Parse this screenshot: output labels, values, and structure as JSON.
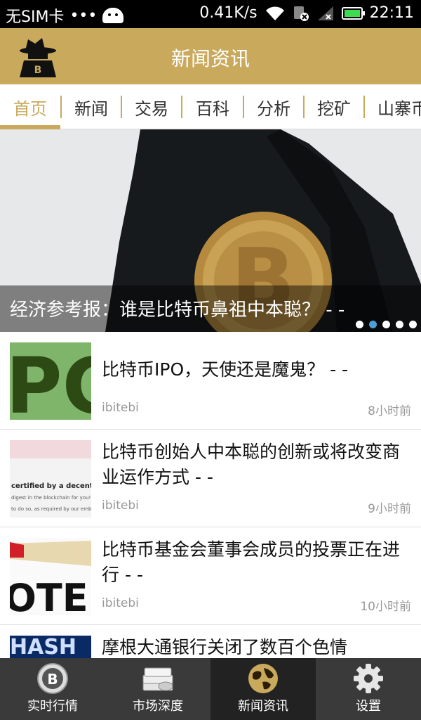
{
  "status_bar": {
    "sim": "无SIM卡",
    "dots": "•••",
    "speed": "0.41K/s",
    "time": "22:11",
    "battery_level": 1.0
  },
  "header": {
    "title": "新闻资讯"
  },
  "tabs": [
    {
      "label": "首页",
      "active": true
    },
    {
      "label": "新闻"
    },
    {
      "label": "交易"
    },
    {
      "label": "百科"
    },
    {
      "label": "分析"
    },
    {
      "label": "挖矿"
    },
    {
      "label": "山寨币"
    }
  ],
  "banner": {
    "caption": "经济参考报：谁是比特币鼻祖中本聪？ - -",
    "page_count": 5,
    "active_page": 2
  },
  "news": [
    {
      "title": "比特币IPO，天使还是魔鬼？ - -",
      "source": "ibitebi",
      "time": "8小时前",
      "thumb_text": "PC"
    },
    {
      "title": "比特币创始人中本聪的创新或将改变商业运作方式 - -",
      "source": "ibitebi",
      "time": "9小时前",
      "thumb_lines": [
        "certified by a decentrali",
        "digest in the blockchain for you!",
        "to do so, as required by our emb"
      ]
    },
    {
      "title": "比特币基金会董事会成员的投票正在进行 - -",
      "source": "ibitebi",
      "time": "10小时前",
      "thumb_text": "OTE"
    },
    {
      "title": "摩根大通银行关闭了数百个色情",
      "thumb_text": "HASH"
    }
  ],
  "bottom_nav": [
    {
      "label": "实时行情",
      "icon": "bitcoin-coin-icon"
    },
    {
      "label": "市场深度",
      "icon": "money-stack-icon"
    },
    {
      "label": "新闻资讯",
      "icon": "globe-icon",
      "active": true
    },
    {
      "label": "设置",
      "icon": "gear-icon"
    }
  ],
  "colors": {
    "accent": "#c9a95c",
    "nav_bg": "#3a3a3a",
    "nav_active_bg": "#222222",
    "dot_active": "#4a9fd8"
  }
}
